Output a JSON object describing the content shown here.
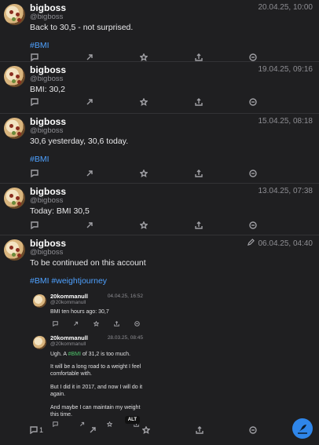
{
  "posts": [
    {
      "name": "bigboss",
      "handle": "@bigboss",
      "time": "20.04.25, 10:00",
      "text": "Back to 30,5 - not surprised.",
      "hashtag": "#BMI"
    },
    {
      "name": "bigboss",
      "handle": "@bigboss",
      "time": "19.04.25, 09:16",
      "text": "BMI: 30,2"
    },
    {
      "name": "bigboss",
      "handle": "@bigboss",
      "time": "15.04.25, 08:18",
      "text": "30,6 yesterday, 30,6 today.",
      "hashtag": "#BMI"
    },
    {
      "name": "bigboss",
      "handle": "@bigboss",
      "time": "13.04.25, 07:38",
      "text": "Today: BMI 30,5"
    },
    {
      "name": "bigboss",
      "handle": "@bigboss",
      "time": "06.04.25, 04:40",
      "text": "To be continued on this account",
      "hashtags": "#BMI #weightjourney",
      "reply_count": "1",
      "quotes": [
        {
          "name": "20kommanull",
          "handle": "@20kommanull",
          "time": "04.04.25, 16:52",
          "text": "BMI ten hours ago: 30,7"
        },
        {
          "name": "20kommanull",
          "handle": "@20kommanull",
          "time": "28.03.25, 08:45",
          "text_a": "Ugh. A ",
          "text_tag": "#BMI",
          "text_b": " of 31,2 is too much.",
          "p2": "It will be a long road to a weight I feel comfortable with.",
          "p3": "But I did it in 2017, and now I will do it again.",
          "p4": "And maybe I can maintain my weight this time.",
          "alt": "ALT"
        }
      ]
    }
  ],
  "icons": [
    "reply-icon",
    "boost-icon",
    "favourite-icon",
    "share-icon",
    "more-icon"
  ],
  "fab_icon": "compose-icon"
}
